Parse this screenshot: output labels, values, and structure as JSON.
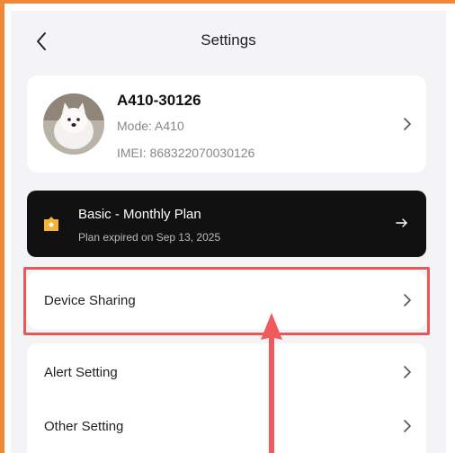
{
  "header": {
    "title": "Settings"
  },
  "device": {
    "name": "A410-30126",
    "mode": "Mode: A410",
    "imei": "IMEI: 868322070030126"
  },
  "plan": {
    "title": "Basic - Monthly Plan",
    "subtitle": "Plan expired on Sep 13, 2025"
  },
  "menu": {
    "device_sharing": "Device Sharing",
    "alert_setting": "Alert Setting",
    "other_setting": "Other Setting"
  },
  "colors": {
    "frame": "#f0883a",
    "highlight": "#e85858",
    "plan_bg": "#111111",
    "plan_icon": "#f5b33a"
  }
}
